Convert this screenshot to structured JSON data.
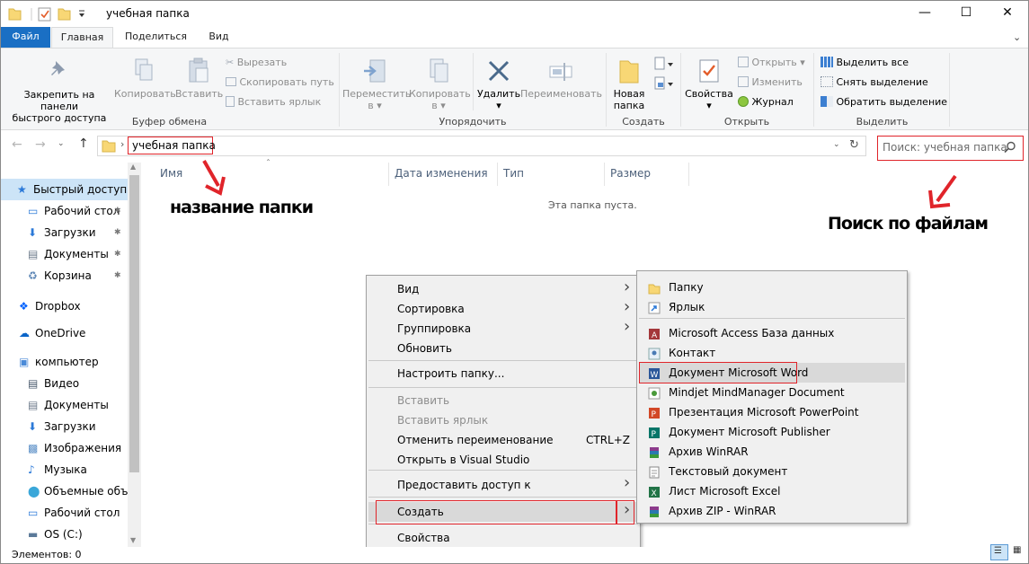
{
  "window": {
    "title": "учебная папка"
  },
  "ribbon_tabs": [
    "Файл",
    "Главная",
    "Поделиться",
    "Вид"
  ],
  "ribbon": {
    "clipboard": {
      "group": "Буфер обмена",
      "pin": "Закрепить на панели\nбыстрого доступа",
      "pin_line1": "Закрепить на панели",
      "pin_line2": "быстрого доступа",
      "copy": "Копировать",
      "paste": "Вставить",
      "cut": "Вырезать",
      "copy_path": "Скопировать путь",
      "paste_shortcut": "Вставить ярлык"
    },
    "organize": {
      "group": "Упорядочить",
      "move_to": "Переместить",
      "move_to_2": "в",
      "copy_to": "Копировать",
      "copy_to_2": "в",
      "delete": "Удалить",
      "rename": "Переименовать"
    },
    "new": {
      "group": "Создать",
      "new_folder_1": "Новая",
      "new_folder_2": "папка"
    },
    "open": {
      "group": "Открыть",
      "properties": "Свойства",
      "open": "Открыть",
      "edit": "Изменить",
      "history": "Журнал"
    },
    "select": {
      "group": "Выделить",
      "select_all": "Выделить все",
      "select_none": "Снять выделение",
      "invert": "Обратить выделение"
    }
  },
  "address": {
    "path": "учебная папка",
    "search_placeholder": "Поиск: учебная папка"
  },
  "sidebar": {
    "items": [
      {
        "label": "Быстрый доступ",
        "icon": "star-icon",
        "selected": true
      },
      {
        "label": "Рабочий стол",
        "icon": "desktop-icon",
        "pinned": true
      },
      {
        "label": "Загрузки",
        "icon": "download-icon",
        "pinned": true
      },
      {
        "label": "Документы",
        "icon": "documents-icon",
        "pinned": true
      },
      {
        "label": "Корзина",
        "icon": "recycle-bin-icon",
        "pinned": true
      },
      {
        "label": "Dropbox",
        "icon": "dropbox-icon"
      },
      {
        "label": "OneDrive",
        "icon": "onedrive-icon"
      },
      {
        "label": "компьютер",
        "icon": "computer-icon"
      },
      {
        "label": "Видео",
        "icon": "video-icon"
      },
      {
        "label": "Документы",
        "icon": "documents-icon"
      },
      {
        "label": "Загрузки",
        "icon": "download-icon"
      },
      {
        "label": "Изображения",
        "icon": "pictures-icon"
      },
      {
        "label": "Музыка",
        "icon": "music-icon"
      },
      {
        "label": "Объемные объ",
        "icon": "3d-objects-icon"
      },
      {
        "label": "Рабочий стол",
        "icon": "desktop-icon"
      },
      {
        "label": "OS (C:)",
        "icon": "drive-icon"
      }
    ]
  },
  "columns": [
    "Имя",
    "Дата изменения",
    "Тип",
    "Размер"
  ],
  "empty_text": "Эта папка пуста.",
  "status": "Элементов: 0",
  "context_menu": {
    "items": [
      {
        "label": "Вид",
        "submenu": true
      },
      {
        "label": "Сортировка",
        "submenu": true
      },
      {
        "label": "Группировка",
        "submenu": true
      },
      {
        "label": "Обновить"
      },
      {
        "label": "Настроить папку..."
      },
      {
        "label": "Вставить",
        "disabled": true
      },
      {
        "label": "Вставить ярлык",
        "disabled": true
      },
      {
        "label": "Отменить переименование",
        "shortcut": "CTRL+Z"
      },
      {
        "label": "Открыть в Visual Studio"
      },
      {
        "label": "Предоставить доступ к",
        "submenu": true
      },
      {
        "label": "Создать",
        "submenu": true,
        "highlighted": true
      },
      {
        "label": "Свойства"
      }
    ]
  },
  "create_submenu": {
    "items": [
      {
        "label": "Папку",
        "icon": "folder-icon"
      },
      {
        "label": "Ярлык",
        "icon": "shortcut-icon"
      },
      {
        "label": "Microsoft Access База данных",
        "icon": "access-icon"
      },
      {
        "label": "Контакт",
        "icon": "contact-icon"
      },
      {
        "label": "Документ Microsoft Word",
        "icon": "word-icon",
        "highlighted": true
      },
      {
        "label": "Mindjet MindManager Document",
        "icon": "mindmanager-icon"
      },
      {
        "label": "Презентация Microsoft PowerPoint",
        "icon": "powerpoint-icon"
      },
      {
        "label": "Документ Microsoft Publisher",
        "icon": "publisher-icon"
      },
      {
        "label": "Архив WinRAR",
        "icon": "winrar-icon"
      },
      {
        "label": "Текстовый документ",
        "icon": "text-document-icon"
      },
      {
        "label": "Лист Microsoft Excel",
        "icon": "excel-icon"
      },
      {
        "label": "Архив ZIP - WinRAR",
        "icon": "zip-icon"
      }
    ]
  },
  "annotations": {
    "folder_name": "название папки",
    "search_files": "Поиск по файлам"
  },
  "colors": {
    "accent": "#1a6fc4",
    "selection": "#cce4f7",
    "highlight_box": "#e0242a",
    "folder": "#f8d775"
  }
}
